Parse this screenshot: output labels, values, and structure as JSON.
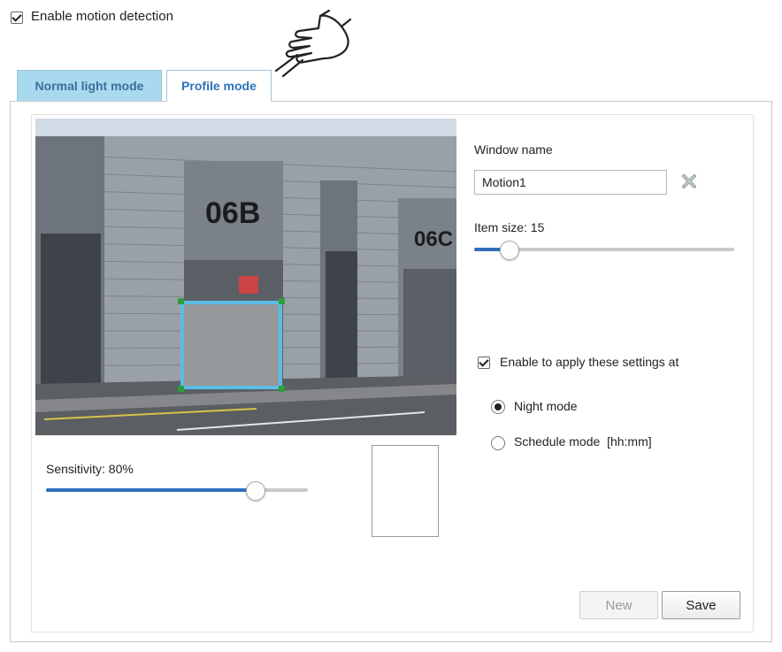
{
  "motion": {
    "enable_label": "Enable motion detection",
    "enabled": true
  },
  "tabs": [
    {
      "label": "Normal light mode",
      "active": false
    },
    {
      "label": "Profile mode",
      "active": true
    }
  ],
  "window": {
    "name_label": "Window name",
    "name_value": "Motion1",
    "item_size_label": "Item size: 15",
    "item_size_value": 15
  },
  "sensitivity": {
    "label": "Sensitivity: 80%",
    "value_percent": 80
  },
  "camera": {
    "building_label_left": "06B",
    "building_label_right": "06C"
  },
  "apply": {
    "checkbox_label": "Enable to apply these settings at",
    "enabled": true,
    "options": [
      {
        "label": "Night mode",
        "selected": true
      },
      {
        "label": "Schedule mode  [hh:mm]",
        "selected": false
      }
    ]
  },
  "buttons": {
    "new_label": "New",
    "save_label": "Save"
  },
  "icons": {
    "delete": "delete-x-icon",
    "pointer": "pointing-hand-icon"
  },
  "colors": {
    "accent": "#2f6fbd",
    "tab_inactive_bg": "#a9d9ee",
    "tab_active_text": "#2a73b8",
    "motion_window_border": "#5bbde6"
  }
}
